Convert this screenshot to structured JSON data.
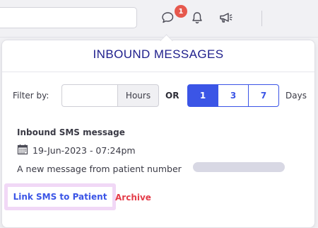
{
  "topbar": {
    "notification_count": "1",
    "icons": [
      "chat-bubble-icon",
      "bell-icon",
      "megaphone-icon"
    ]
  },
  "panel": {
    "title": "INBOUND MESSAGES",
    "filter": {
      "label": "Filter by:",
      "hours_value": "",
      "hours_unit": "Hours",
      "or_label": "OR",
      "day_options": [
        "1",
        "3",
        "7"
      ],
      "selected_day": "1",
      "days_label": "Days"
    },
    "message": {
      "title": "Inbound SMS message",
      "date": "19-Jun-2023 - 07:24pm",
      "text": "A new message from patient number",
      "link_label": "Link SMS to Patient",
      "archive_label": "Archive"
    }
  },
  "colors": {
    "accent": "#3b55e6",
    "title": "#1f1f8c",
    "badge": "#e6584d",
    "archive": "#e43d4a",
    "highlight": "#f1d8f6"
  }
}
